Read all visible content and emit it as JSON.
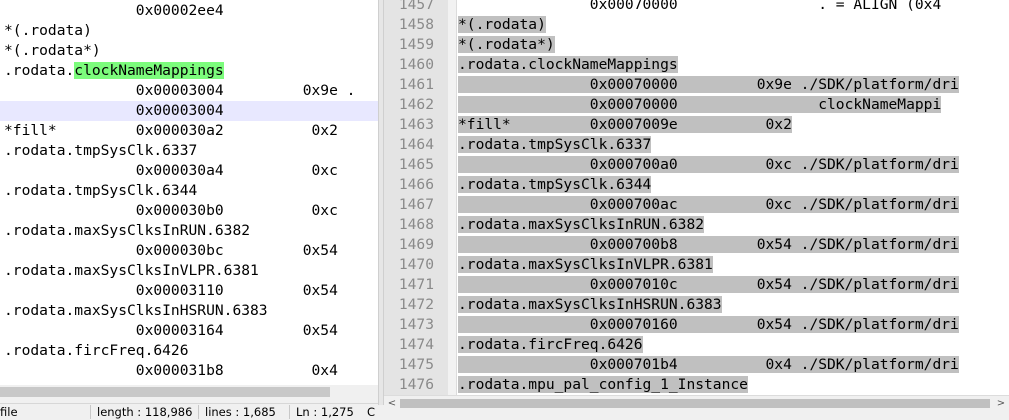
{
  "left_editor": {
    "lines": [
      "               0x00002ee4",
      "*(.rodata)",
      "*(.rodata*)",
      ".rodata.",
      "               0x00003004         0x9e .",
      "               0x00003004",
      "*fill*         0x000030a2          0x2",
      ".rodata.tmpSysClk.6337",
      "               0x000030a4          0xc",
      ".rodata.tmpSysClk.6344",
      "               0x000030b0          0xc",
      ".rodata.maxSysClksInRUN.6382",
      "               0x000030bc         0x54",
      ".rodata.maxSysClksInVLPR.6381",
      "               0x00003110         0x54",
      ".rodata.maxSysClksInHSRUN.6383",
      "               0x00003164         0x54",
      ".rodata.fircFreq.6426",
      "               0x000031b8          0x4"
    ],
    "highlight_word": "clockNameMappings"
  },
  "right_editor": {
    "line_numbers": [
      "1457",
      "1458",
      "1459",
      "1460",
      "1461",
      "1462",
      "1463",
      "1464",
      "1465",
      "1466",
      "1467",
      "1468",
      "1469",
      "1470",
      "1471",
      "1472",
      "1473",
      "1474",
      "1475",
      "1476"
    ],
    "lines": [
      "               0x00070000                . = ALIGN (0x4",
      "*(.rodata)",
      "*(.rodata*)",
      ".rodata.clockNameMappings",
      "               0x00070000         0x9e ./SDK/platform/dri",
      "               0x00070000                clockNameMappi",
      "*fill*         0x0007009e          0x2",
      ".rodata.tmpSysClk.6337",
      "               0x000700a0          0xc ./SDK/platform/dri",
      ".rodata.tmpSysClk.6344",
      "               0x000700ac          0xc ./SDK/platform/dri",
      ".rodata.maxSysClksInRUN.6382",
      "               0x000700b8         0x54 ./SDK/platform/dri",
      ".rodata.maxSysClksInVLPR.6381",
      "               0x0007010c         0x54 ./SDK/platform/dri",
      ".rodata.maxSysClksInHSRUN.6383",
      "               0x00070160         0x54 ./SDK/platform/dri",
      ".rodata.fircFreq.6426",
      "               0x000701b4          0x4 ./SDK/platform/dri",
      ".rodata.mpu_pal_config_1_Instance"
    ]
  },
  "statusbar": {
    "file_label": "file",
    "length_label": "length : 118,986",
    "lines_label": "lines : 1,685",
    "ln_label": "Ln : 1,275",
    "col_label": "C"
  },
  "scroll": {
    "left_arrow": "<",
    "right_arrow": ">"
  },
  "colors": {
    "selection": "#c0c0c0",
    "word_highlight": "#7cfc7c",
    "caret_line": "#e8e8ff",
    "gutter": "#e4e4e4"
  }
}
